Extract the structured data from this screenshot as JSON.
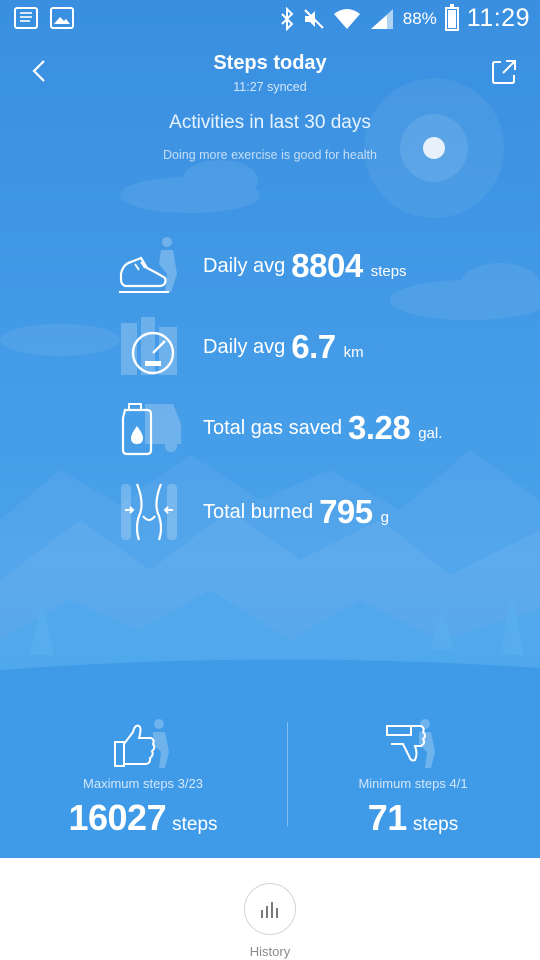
{
  "status_bar": {
    "battery": "88%",
    "time": "11:29",
    "icons": [
      "notes-icon",
      "image-icon",
      "bluetooth-icon",
      "mute-icon",
      "wifi-icon",
      "signal-icon",
      "battery-icon"
    ],
    "battery_level": 0.88
  },
  "header": {
    "title": "Steps today",
    "subtitle": "11:27 synced",
    "back_icon": "back-chevron-icon",
    "share_icon": "share-icon"
  },
  "summary": {
    "title": "Activities in last 30 days",
    "subtitle": "Doing more exercise is good for health"
  },
  "stats": [
    {
      "icon": "shoe-icon",
      "label": "Daily avg",
      "value": "8804",
      "unit": "steps"
    },
    {
      "icon": "speedometer-icon",
      "label": "Daily avg",
      "value": "6.7",
      "unit": "km"
    },
    {
      "icon": "gas-can-icon",
      "label": "Total gas saved",
      "value": "3.28",
      "unit": "gal."
    },
    {
      "icon": "waist-icon",
      "label": "Total burned",
      "value": "795",
      "unit": "g"
    }
  ],
  "extremes": {
    "max": {
      "icon": "thumbs-up-icon",
      "caption": "Maximum steps 3/23",
      "value": "16027",
      "unit": "steps"
    },
    "min": {
      "icon": "thumbs-down-icon",
      "caption": "Minimum steps 4/1",
      "value": "71",
      "unit": "steps"
    }
  },
  "nav": {
    "history_label": "History",
    "history_icon": "bar-chart-icon"
  },
  "colors": {
    "background": "#4299e6",
    "text": "#ffffff",
    "nav_background": "#ffffff"
  }
}
